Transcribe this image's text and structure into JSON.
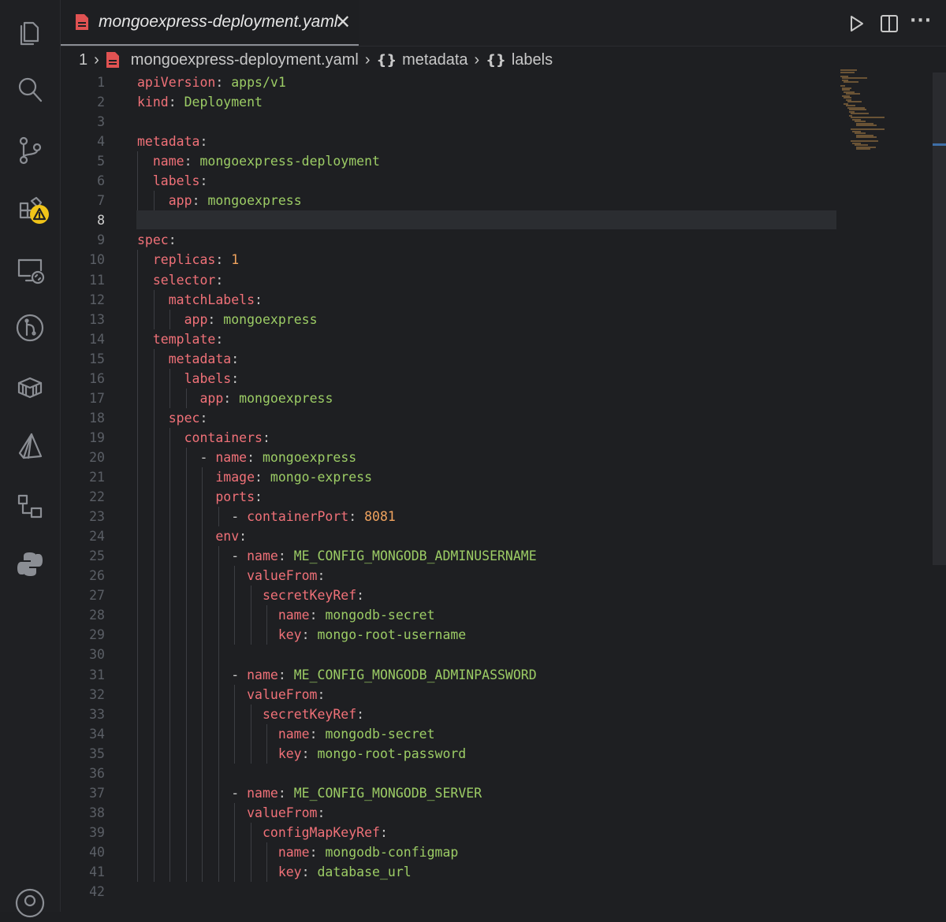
{
  "activity_bar": {
    "items": [
      {
        "name": "explorer-icon"
      },
      {
        "name": "search-icon"
      },
      {
        "name": "source-control-icon"
      },
      {
        "name": "extensions-icon",
        "badge": "warning"
      },
      {
        "name": "remote-explorer-icon"
      },
      {
        "name": "git-graph-icon"
      },
      {
        "name": "docker-icon"
      },
      {
        "name": "kubernetes-icon"
      },
      {
        "name": "diagram-icon"
      },
      {
        "name": "python-icon"
      },
      {
        "name": "accounts-icon"
      }
    ]
  },
  "tab": {
    "title": "mongoexpress-deployment.yaml",
    "close": "✕",
    "icon": "yaml-file-icon"
  },
  "tab_actions": {
    "run": "run-icon",
    "split": "split-editor-icon",
    "more": "···"
  },
  "breadcrumb": {
    "root": "1",
    "file": "mongoexpress-deployment.yaml",
    "seg1": "metadata",
    "seg2": "labels",
    "brace": "{}",
    "sep": "›"
  },
  "editor": {
    "active_line": 8,
    "lines": [
      [
        [
          "k",
          "apiVersion"
        ],
        [
          "p",
          ": "
        ],
        [
          "s",
          "apps/v1"
        ]
      ],
      [
        [
          "k",
          "kind"
        ],
        [
          "p",
          ": "
        ],
        [
          "s",
          "Deployment"
        ]
      ],
      [],
      [
        [
          "k",
          "metadata"
        ],
        [
          "p",
          ":"
        ]
      ],
      [
        [
          "p",
          "  "
        ],
        [
          "k",
          "name"
        ],
        [
          "p",
          ": "
        ],
        [
          "s",
          "mongoexpress-deployment"
        ]
      ],
      [
        [
          "p",
          "  "
        ],
        [
          "k",
          "labels"
        ],
        [
          "p",
          ":"
        ]
      ],
      [
        [
          "p",
          "    "
        ],
        [
          "k",
          "app"
        ],
        [
          "p",
          ": "
        ],
        [
          "s",
          "mongoexpress"
        ]
      ],
      [],
      [
        [
          "k",
          "spec"
        ],
        [
          "p",
          ":"
        ]
      ],
      [
        [
          "p",
          "  "
        ],
        [
          "k",
          "replicas"
        ],
        [
          "p",
          ": "
        ],
        [
          "n",
          "1"
        ]
      ],
      [
        [
          "p",
          "  "
        ],
        [
          "k",
          "selector"
        ],
        [
          "p",
          ":"
        ]
      ],
      [
        [
          "p",
          "    "
        ],
        [
          "k",
          "matchLabels"
        ],
        [
          "p",
          ":"
        ]
      ],
      [
        [
          "p",
          "      "
        ],
        [
          "k",
          "app"
        ],
        [
          "p",
          ": "
        ],
        [
          "s",
          "mongoexpress"
        ]
      ],
      [
        [
          "p",
          "  "
        ],
        [
          "k",
          "template"
        ],
        [
          "p",
          ":"
        ]
      ],
      [
        [
          "p",
          "    "
        ],
        [
          "k",
          "metadata"
        ],
        [
          "p",
          ":"
        ]
      ],
      [
        [
          "p",
          "      "
        ],
        [
          "k",
          "labels"
        ],
        [
          "p",
          ":"
        ]
      ],
      [
        [
          "p",
          "        "
        ],
        [
          "k",
          "app"
        ],
        [
          "p",
          ": "
        ],
        [
          "s",
          "mongoexpress"
        ]
      ],
      [
        [
          "p",
          "    "
        ],
        [
          "k",
          "spec"
        ],
        [
          "p",
          ":"
        ]
      ],
      [
        [
          "p",
          "      "
        ],
        [
          "k",
          "containers"
        ],
        [
          "p",
          ":"
        ]
      ],
      [
        [
          "p",
          "        "
        ],
        [
          "d",
          "- "
        ],
        [
          "k",
          "name"
        ],
        [
          "p",
          ": "
        ],
        [
          "s",
          "mongoexpress"
        ]
      ],
      [
        [
          "p",
          "          "
        ],
        [
          "k",
          "image"
        ],
        [
          "p",
          ": "
        ],
        [
          "s",
          "mongo-express"
        ]
      ],
      [
        [
          "p",
          "          "
        ],
        [
          "k",
          "ports"
        ],
        [
          "p",
          ":"
        ]
      ],
      [
        [
          "p",
          "            "
        ],
        [
          "d",
          "- "
        ],
        [
          "k",
          "containerPort"
        ],
        [
          "p",
          ": "
        ],
        [
          "n",
          "8081"
        ]
      ],
      [
        [
          "p",
          "          "
        ],
        [
          "k",
          "env"
        ],
        [
          "p",
          ":"
        ]
      ],
      [
        [
          "p",
          "            "
        ],
        [
          "d",
          "- "
        ],
        [
          "k",
          "name"
        ],
        [
          "p",
          ": "
        ],
        [
          "s",
          "ME_CONFIG_MONGODB_ADMINUSERNAME"
        ]
      ],
      [
        [
          "p",
          "              "
        ],
        [
          "k",
          "valueFrom"
        ],
        [
          "p",
          ":"
        ]
      ],
      [
        [
          "p",
          "                "
        ],
        [
          "k",
          "secretKeyRef"
        ],
        [
          "p",
          ":"
        ]
      ],
      [
        [
          "p",
          "                  "
        ],
        [
          "k",
          "name"
        ],
        [
          "p",
          ": "
        ],
        [
          "s",
          "mongodb-secret"
        ]
      ],
      [
        [
          "p",
          "                  "
        ],
        [
          "k",
          "key"
        ],
        [
          "p",
          ": "
        ],
        [
          "s",
          "mongo-root-username"
        ]
      ],
      [],
      [
        [
          "p",
          "            "
        ],
        [
          "d",
          "- "
        ],
        [
          "k",
          "name"
        ],
        [
          "p",
          ": "
        ],
        [
          "s",
          "ME_CONFIG_MONGODB_ADMINPASSWORD"
        ]
      ],
      [
        [
          "p",
          "              "
        ],
        [
          "k",
          "valueFrom"
        ],
        [
          "p",
          ":"
        ]
      ],
      [
        [
          "p",
          "                "
        ],
        [
          "k",
          "secretKeyRef"
        ],
        [
          "p",
          ":"
        ]
      ],
      [
        [
          "p",
          "                  "
        ],
        [
          "k",
          "name"
        ],
        [
          "p",
          ": "
        ],
        [
          "s",
          "mongodb-secret"
        ]
      ],
      [
        [
          "p",
          "                  "
        ],
        [
          "k",
          "key"
        ],
        [
          "p",
          ": "
        ],
        [
          "s",
          "mongo-root-password"
        ]
      ],
      [],
      [
        [
          "p",
          "            "
        ],
        [
          "d",
          "- "
        ],
        [
          "k",
          "name"
        ],
        [
          "p",
          ": "
        ],
        [
          "s",
          "ME_CONFIG_MONGODB_SERVER"
        ]
      ],
      [
        [
          "p",
          "              "
        ],
        [
          "k",
          "valueFrom"
        ],
        [
          "p",
          ":"
        ]
      ],
      [
        [
          "p",
          "                "
        ],
        [
          "k",
          "configMapKeyRef"
        ],
        [
          "p",
          ":"
        ]
      ],
      [
        [
          "p",
          "                  "
        ],
        [
          "k",
          "name"
        ],
        [
          "p",
          ": "
        ],
        [
          "s",
          "mongodb-configmap"
        ]
      ],
      [
        [
          "p",
          "                  "
        ],
        [
          "k",
          "key"
        ],
        [
          "p",
          ": "
        ],
        [
          "s",
          "database_url"
        ]
      ],
      []
    ]
  },
  "colors": {
    "key": "#f07178",
    "string": "#9ccc65",
    "number": "#f0a35e",
    "background": "#1e1f22",
    "warning_badge": "#f0c419"
  }
}
